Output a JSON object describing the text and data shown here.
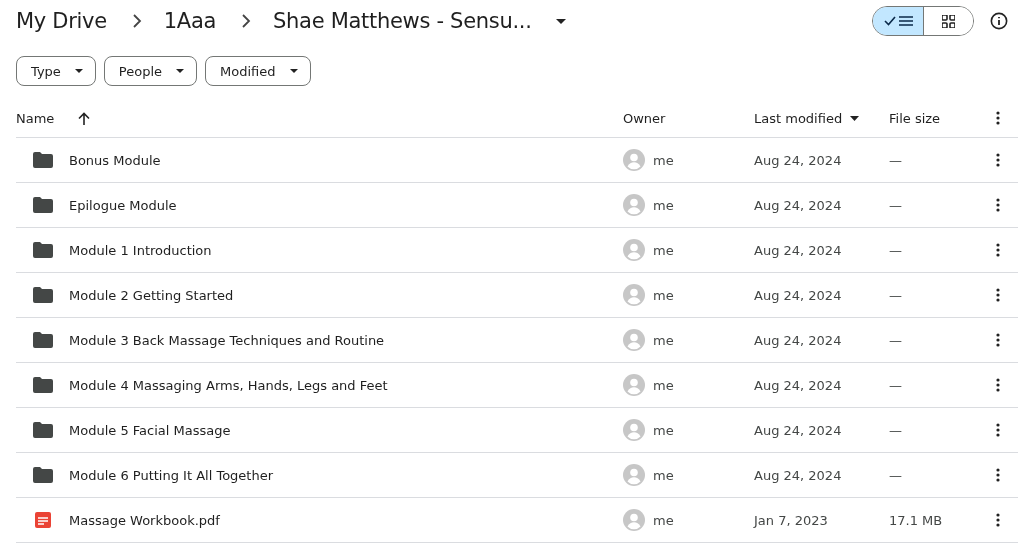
{
  "breadcrumb": [
    "My Drive",
    "1Aaa",
    "Shae Matthews - Sensu..."
  ],
  "view_toggle": [
    {
      "kind": "list",
      "selected": true
    },
    {
      "kind": "grid",
      "selected": false
    }
  ],
  "filters": [
    "Type",
    "People",
    "Modified"
  ],
  "table": {
    "columns": [
      {
        "label": "Name",
        "sorted": true
      },
      {
        "label": "Owner",
        "sorted": false
      },
      {
        "label": "Last modified",
        "sorted": false
      },
      {
        "label": "File size",
        "sorted": false
      }
    ],
    "rows": [
      {
        "kind": "folder",
        "name": "Bonus Module",
        "owner": "me",
        "modified": "Aug 24, 2024",
        "size": "—"
      },
      {
        "kind": "folder",
        "name": "Epilogue Module",
        "owner": "me",
        "modified": "Aug 24, 2024",
        "size": "—"
      },
      {
        "kind": "folder",
        "name": "Module 1 Introduction",
        "owner": "me",
        "modified": "Aug 24, 2024",
        "size": "—"
      },
      {
        "kind": "folder",
        "name": "Module 2 Getting Started",
        "owner": "me",
        "modified": "Aug 24, 2024",
        "size": "—"
      },
      {
        "kind": "folder",
        "name": "Module 3 Back Massage Techniques and Routine",
        "owner": "me",
        "modified": "Aug 24, 2024",
        "size": "—"
      },
      {
        "kind": "folder",
        "name": "Module 4 Massaging Arms, Hands, Legs and Feet",
        "owner": "me",
        "modified": "Aug 24, 2024",
        "size": "—"
      },
      {
        "kind": "folder",
        "name": "Module 5 Facial Massage",
        "owner": "me",
        "modified": "Aug 24, 2024",
        "size": "—"
      },
      {
        "kind": "folder",
        "name": "Module 6 Putting It All Together",
        "owner": "me",
        "modified": "Aug 24, 2024",
        "size": "—"
      },
      {
        "kind": "pdf",
        "name": "Massage Workbook.pdf",
        "owner": "me",
        "modified": "Jan 7, 2023",
        "size": "17.1 MB"
      }
    ]
  }
}
